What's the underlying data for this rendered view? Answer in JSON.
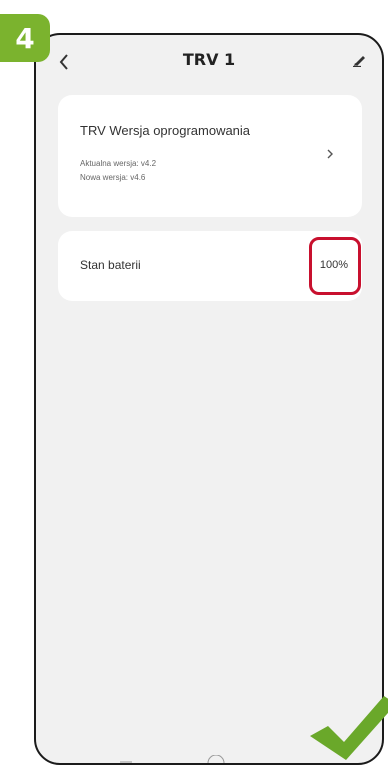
{
  "step": {
    "number": "4"
  },
  "header": {
    "title": "TRV 1"
  },
  "firmware": {
    "title": "TRV Wersja oprogramowania",
    "current_version": "Aktualna wersja: v4.2",
    "new_version": "Nowa wersja: v4.6"
  },
  "battery": {
    "label": "Stan baterii",
    "value": "100%"
  },
  "colors": {
    "badge_green": "#7bb32e",
    "highlight_red": "#c8102e",
    "check_green": "#6aa82a",
    "screen_bg": "#f1f1f1"
  },
  "icons": [
    "chevron-left-icon",
    "edit-pencil-icon",
    "chevron-right-icon",
    "checkmark-icon"
  ]
}
